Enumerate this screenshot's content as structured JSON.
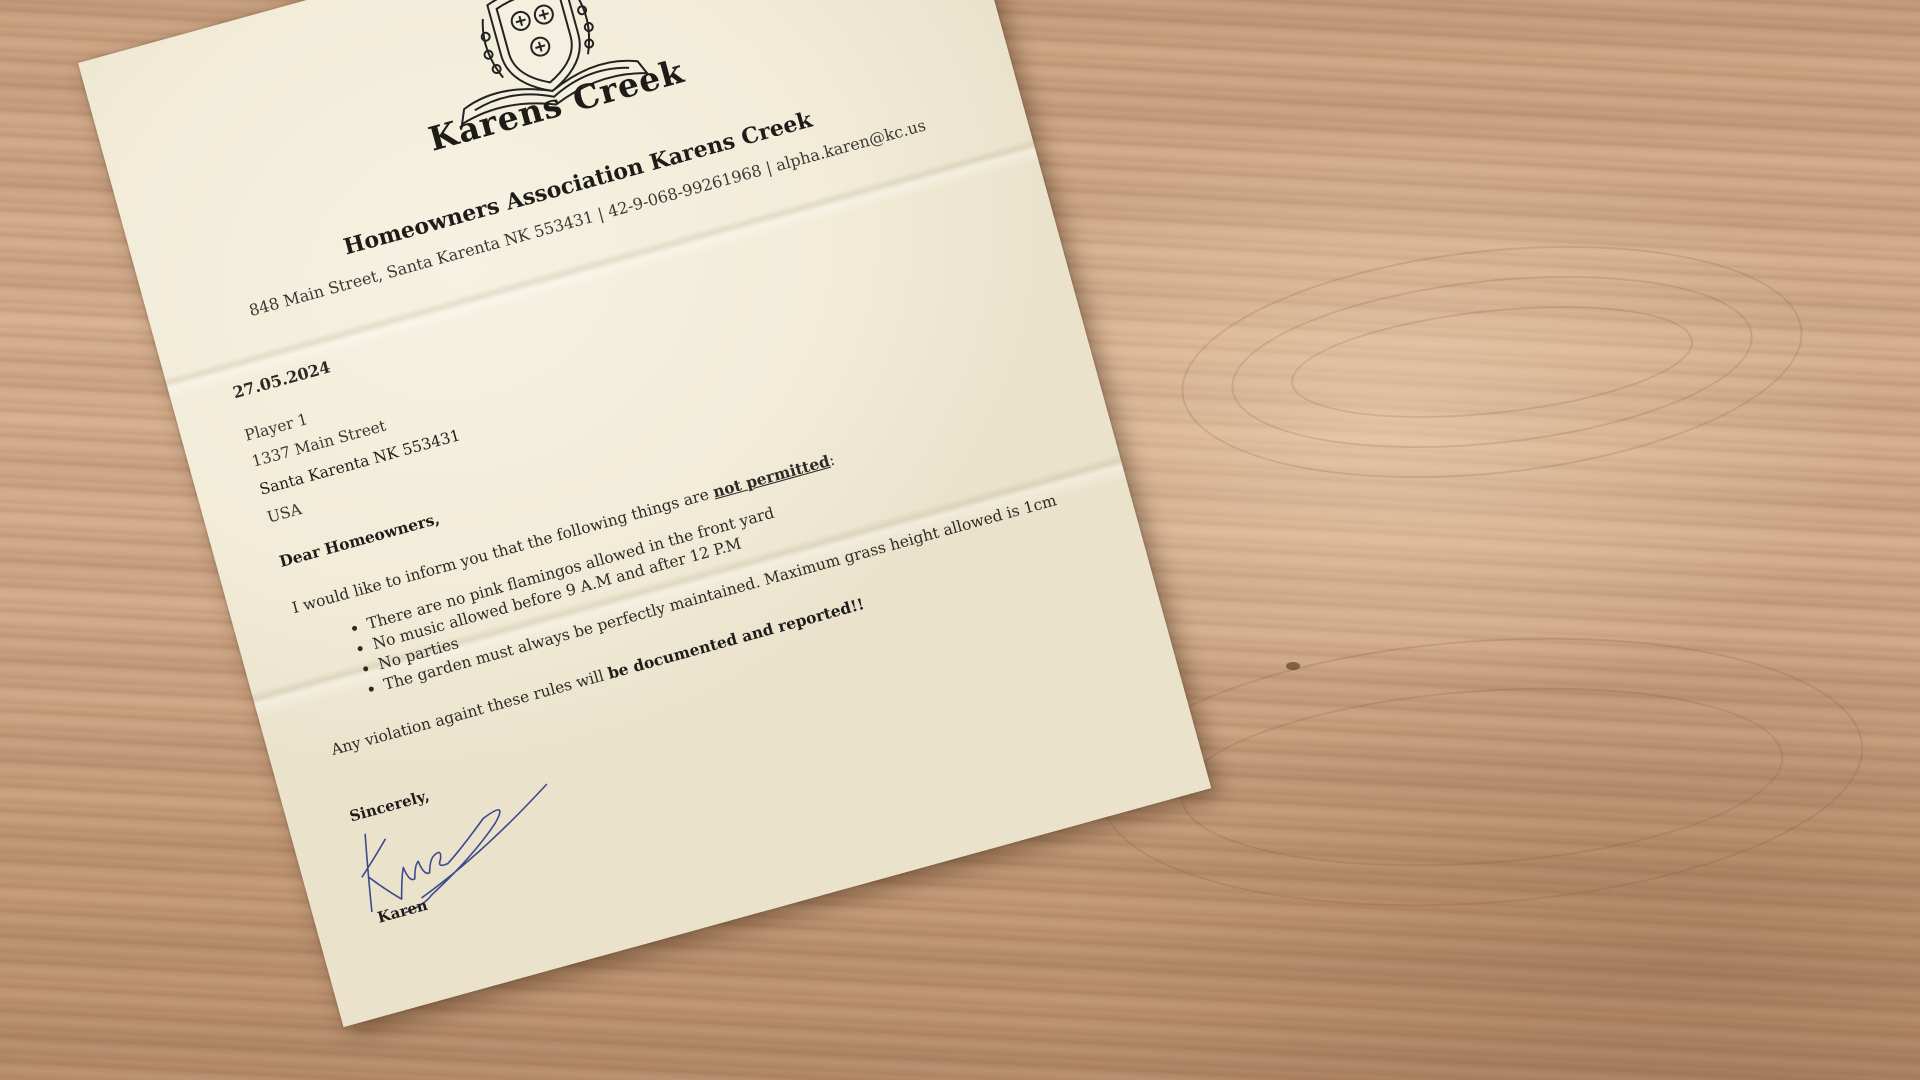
{
  "crest": {
    "name": "Karens Creek"
  },
  "letterhead": {
    "title": "Homeowners Association Karens Creek",
    "address_line": "848 Main Street, Santa Karenta NK 553431 | 42-9-068-99261968 | alpha.karen@kc.us"
  },
  "date": "27.05.2024",
  "recipient": {
    "name": "Player 1",
    "street": "1337 Main Street",
    "city": "Santa Karenta NK 553431",
    "country": "USA"
  },
  "greeting": "Dear Homeowners,",
  "intro": {
    "text": "I would like to inform you that the following things are ",
    "emphasis": "not permitted",
    "suffix": ":"
  },
  "rules": [
    "There are no pink flamingos allowed in the front yard",
    "No music allowed before 9 A.M and after 12 P.M",
    "No parties",
    "The garden must always be perfectly maintained. Maximum grass height allowed is 1cm"
  ],
  "closing": {
    "text": "Any violation againt these rules will ",
    "emphasis": "be documented and reported!!"
  },
  "sign_off": {
    "salutation": "Sincerely,",
    "signer": "Karen"
  },
  "colors": {
    "paper": "#f2ecd9",
    "ink": "#262421",
    "signature_ink": "#3b4a8c",
    "wood": "#d2ab8a"
  }
}
